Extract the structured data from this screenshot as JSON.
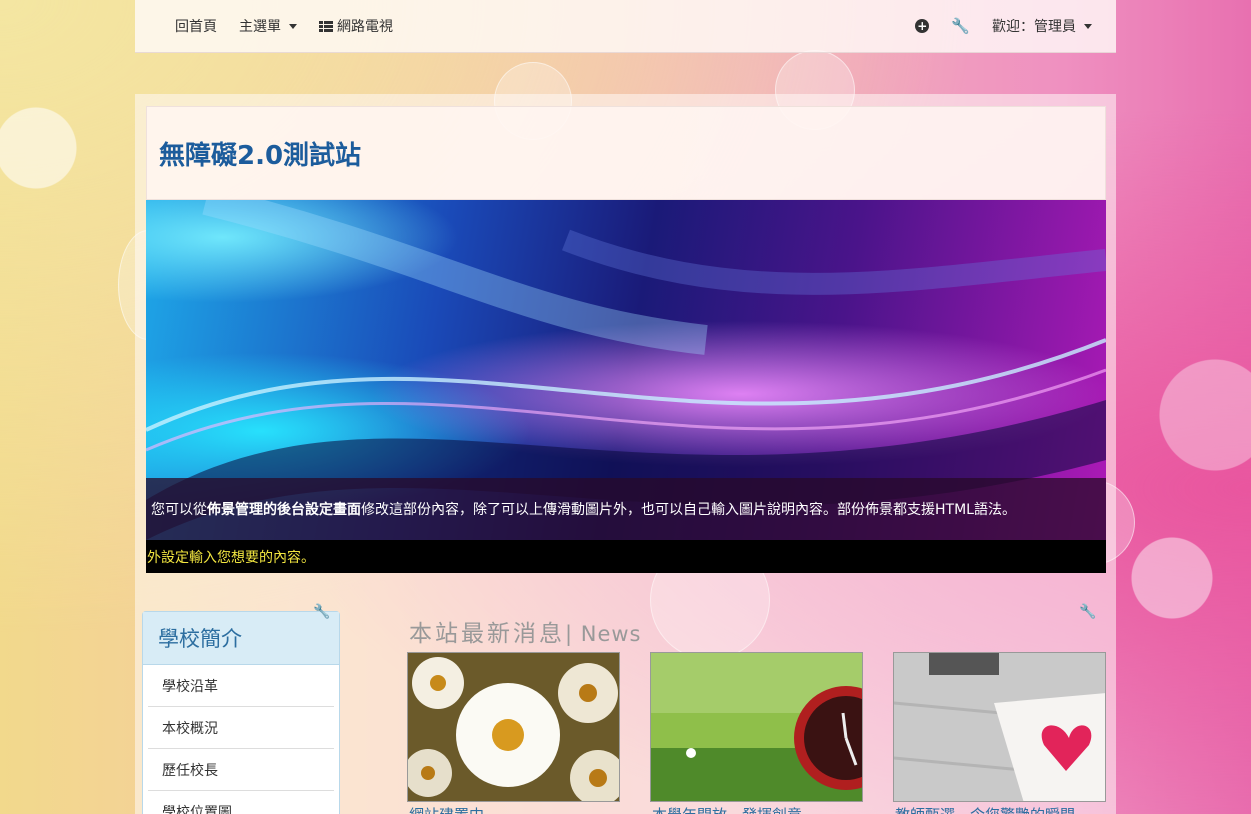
{
  "navbar": {
    "home": "回首頁",
    "main_menu": "主選單",
    "web_tv": "網路電視",
    "welcome": "歡迎：管理員",
    "icons": [
      "plus-circle-icon",
      "wrench-icon",
      "list-icon",
      "caret-down-icon"
    ]
  },
  "site": {
    "title": "無障礙2.0測試站"
  },
  "banner": {
    "caption_prefix": "您可以從",
    "caption_bold": "佈景管理的後台設定畫面",
    "caption_suffix": "修改這部份內容，除了可以上傳滑動圖片外，也可以自己輸入圖片說明內容。部份佈景都支援HTML語法。",
    "caption_second": "外設定輸入您想要的內容。"
  },
  "sidebar": {
    "title": "學校簡介",
    "items": [
      {
        "label": "學校沿革"
      },
      {
        "label": "本校概況"
      },
      {
        "label": "歷任校長"
      },
      {
        "label": "學校位置圖"
      }
    ]
  },
  "news": {
    "title": "本站最新消息",
    "title_suffix": "| News",
    "items": [
      {
        "caption": "網站建置中"
      },
      {
        "caption": "本學年開放…發揮創意"
      },
      {
        "caption": "教師甄選…令您驚艷的瞬間"
      }
    ]
  },
  "colors": {
    "title_blue": "#1c5c9c",
    "caption_yellow": "#f2e640",
    "panel_head": "#d8ecf6"
  }
}
